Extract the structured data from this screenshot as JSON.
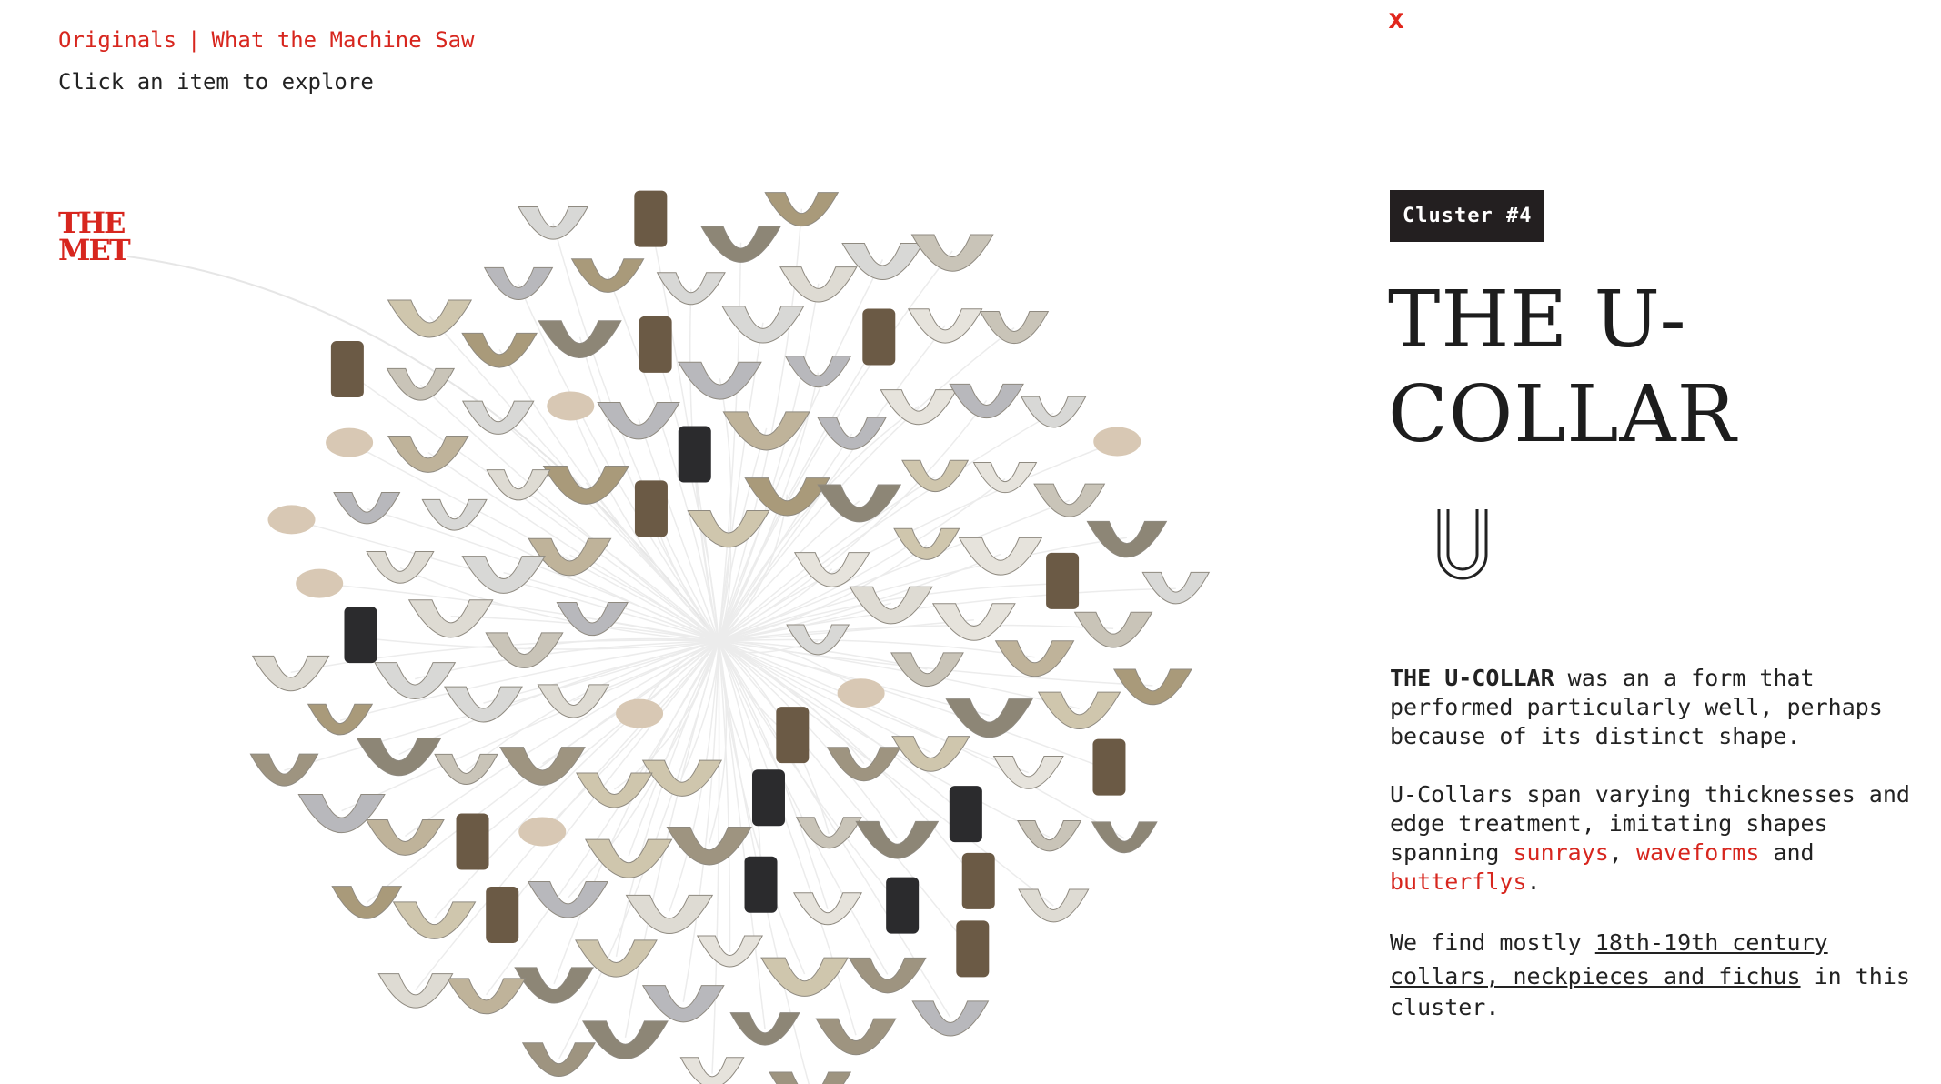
{
  "nav": {
    "originals": "Originals",
    "separator": "|",
    "section": "What the Machine Saw"
  },
  "hint": "Click an item to explore",
  "logo": {
    "line1": "THE",
    "line2": "MET"
  },
  "close": "x",
  "panel": {
    "badge": "Cluster #4",
    "title": "THE U-COLLAR",
    "glyph": "u-collar-outline-icon",
    "p1_bold": "THE U-COLLAR",
    "p1_rest": " was an a form that performed particularly well, perhaps because of its distinct shape.",
    "p2_start": "U-Collars span varying thicknesses and edge treatment, imitating shapes spanning ",
    "link_sunrays": "sunrays",
    "comma": ", ",
    "link_waveforms": "waveforms",
    "and": " and ",
    "link_butterflys": "butterflys",
    "period": ".",
    "p3_start": "We find mostly ",
    "p3_link": "18th-19th century collars, neckpieces and fichus",
    "p3_end": " in this cluster."
  },
  "colors": {
    "accent": "#d7261e",
    "badge_bg": "#231f20"
  }
}
